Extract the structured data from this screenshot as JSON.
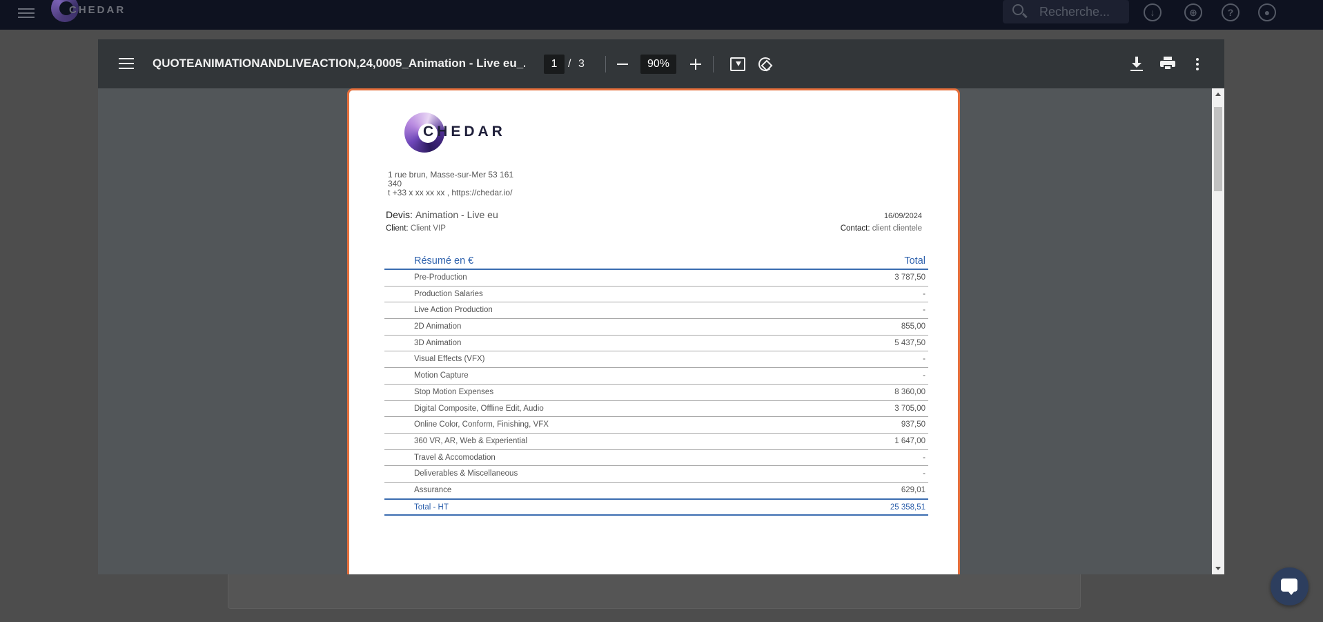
{
  "app_bar": {
    "brand": "CHEDAR",
    "search_placeholder": "Recherche...",
    "icons": [
      "menu-icon",
      "cloud-download-icon",
      "globe-icon",
      "help-icon",
      "account-icon"
    ]
  },
  "viewer": {
    "title": "QUOTEANIMATIONANDLIVEACTION,24,0005_Animation - Live eu_...",
    "current_page": "1",
    "page_separator": "/",
    "total_pages": "3",
    "zoom": "90%"
  },
  "document": {
    "brand": "CHEDAR",
    "address_line1": "1 rue brun, Masse-sur-Mer 53 161",
    "address_line2": "340",
    "address_line3": "t +33 x xx xx xx , https://chedar.io/",
    "devis_label": "Devis:",
    "devis_value": "Animation - Live eu",
    "date": "16/09/2024",
    "client_label": "Client:",
    "client_value": "Client VIP",
    "contact_label": "Contact:",
    "contact_value": "client clientele",
    "summary_header": "Résumé en €",
    "total_header": "Total",
    "rows": [
      {
        "label": "Pre-Production",
        "value": "3 787,50"
      },
      {
        "label": "Production Salaries",
        "value": "-"
      },
      {
        "label": "Live Action Production",
        "value": "-"
      },
      {
        "label": "2D Animation",
        "value": "855,00"
      },
      {
        "label": "3D Animation",
        "value": "5 437,50"
      },
      {
        "label": "Visual Effects (VFX)",
        "value": "-"
      },
      {
        "label": "Motion Capture",
        "value": "-"
      },
      {
        "label": "Stop Motion Expenses",
        "value": "8 360,00"
      },
      {
        "label": "Digital Composite, Offline Edit, Audio",
        "value": "3 705,00"
      },
      {
        "label": "Online Color, Conform, Finishing, VFX",
        "value": "937,50"
      },
      {
        "label": "360 VR, AR, Web & Experiential",
        "value": "1 647,00"
      },
      {
        "label": "Travel & Accomodation",
        "value": "-"
      },
      {
        "label": "Deliverables & Miscellaneous",
        "value": "-"
      },
      {
        "label": "Assurance",
        "value": "629,01"
      }
    ],
    "total_label": "Total - HT",
    "total_value": "25 358,51"
  },
  "colors": {
    "accent_blue": "#2f62ad",
    "page_border": "#e56f3c",
    "toolbar": "#323639"
  }
}
